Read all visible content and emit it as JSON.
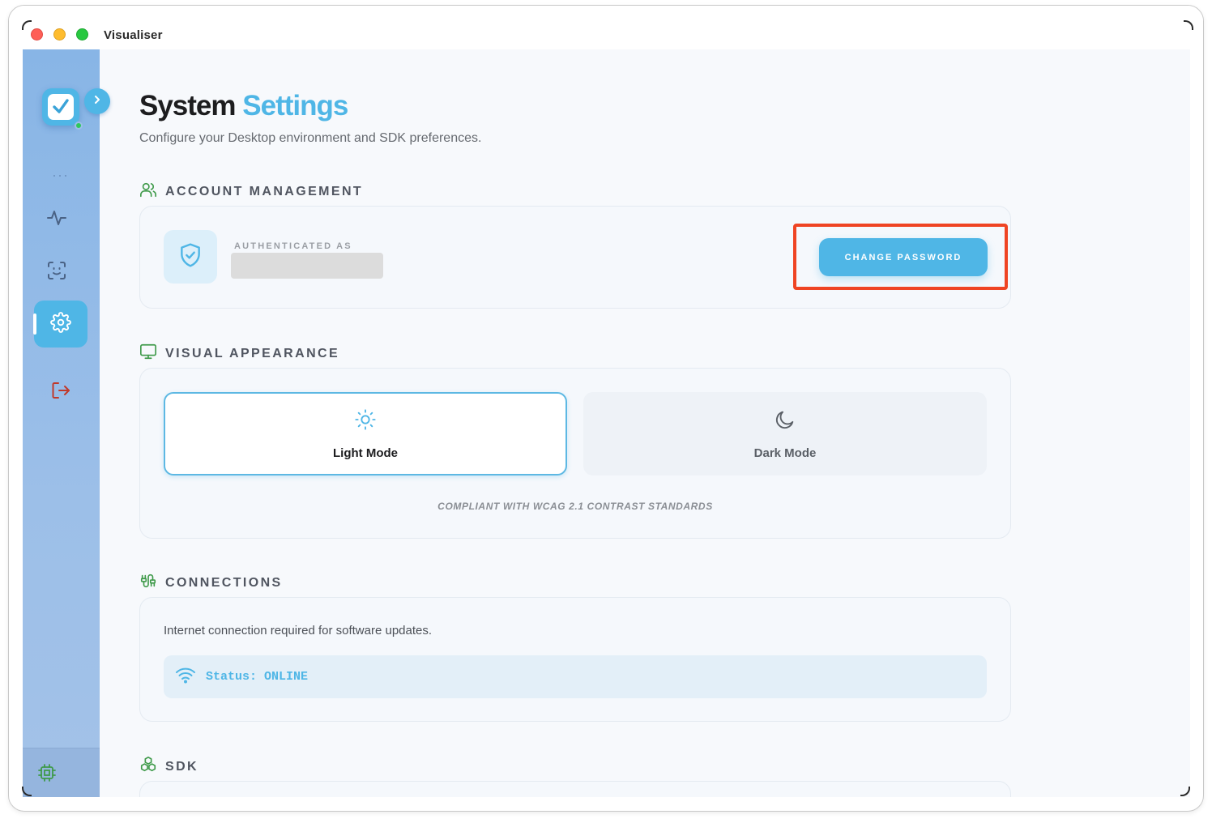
{
  "window": {
    "title": "Visualiser"
  },
  "sidebar": {
    "more_label": "···",
    "items": [
      {
        "name": "activity",
        "icon": "activity-icon"
      },
      {
        "name": "face-scan",
        "icon": "face-scan-icon"
      },
      {
        "name": "settings",
        "icon": "gear-icon",
        "active": true
      },
      {
        "name": "logout",
        "icon": "logout-icon"
      }
    ],
    "footer_icon": "chip-icon"
  },
  "header": {
    "title_part1": "System",
    "title_part2": "Settings",
    "subtitle": "Configure your Desktop environment and SDK preferences."
  },
  "account": {
    "section_label": "ACCOUNT MANAGEMENT",
    "auth_label": "AUTHENTICATED AS",
    "change_password_label": "CHANGE PASSWORD"
  },
  "appearance": {
    "section_label": "VISUAL APPEARANCE",
    "light_label": "Light Mode",
    "dark_label": "Dark Mode",
    "selected": "Light Mode",
    "note": "COMPLIANT WITH WCAG 2.1 CONTRAST STANDARDS"
  },
  "connections": {
    "section_label": "CONNECTIONS",
    "description": "Internet connection required for software updates.",
    "status": "Status: ONLINE"
  },
  "sdk": {
    "section_label": "SDK"
  },
  "colors": {
    "accent": "#4fb6e6",
    "sidebar": "#9cbfe8",
    "highlight": "#ef4423",
    "green_icon": "#3f9a4a",
    "logout_icon": "#c0392b"
  }
}
